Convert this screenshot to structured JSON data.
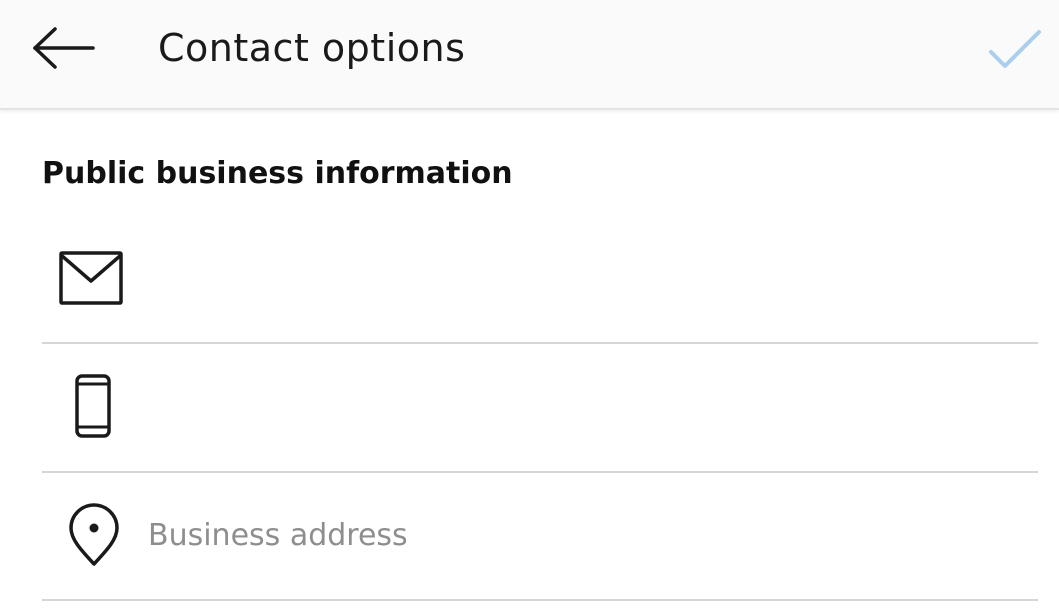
{
  "header": {
    "title": "Contact options",
    "back_icon": "arrow-left-icon",
    "confirm_icon": "checkmark-icon",
    "confirm_color": "#a9cff0"
  },
  "section": {
    "heading": "Public business information"
  },
  "fields": {
    "email": {
      "icon": "envelope-icon",
      "value": ""
    },
    "phone": {
      "icon": "mobile-phone-icon",
      "value": ""
    },
    "address": {
      "icon": "map-pin-icon",
      "value": "",
      "placeholder": "Business address"
    }
  },
  "colors": {
    "header_bg": "#fafafa",
    "divider": "#d6d6d6",
    "text": "#1a1a1a",
    "placeholder": "#8e8e8e"
  }
}
